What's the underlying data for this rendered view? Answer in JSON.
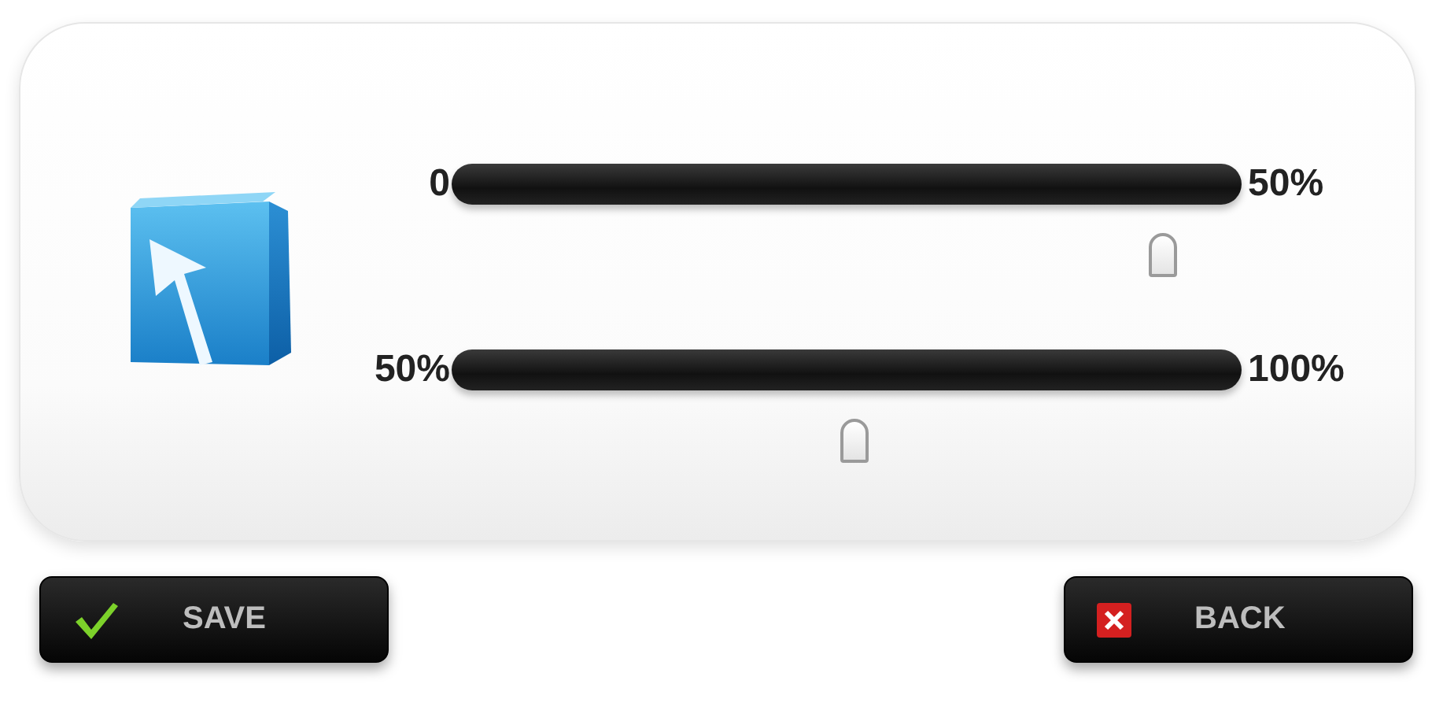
{
  "sliders": [
    {
      "min_label": "0",
      "max_label": "50%",
      "level": 0.9
    },
    {
      "min_label": "50%",
      "max_label": "100%",
      "level": 0.51
    }
  ],
  "buttons": [
    {
      "kind": "save",
      "label": "SAVE"
    },
    {
      "kind": "back",
      "label": "BACK"
    }
  ]
}
